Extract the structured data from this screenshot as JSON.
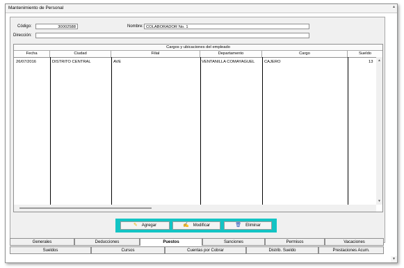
{
  "window": {
    "title": "Mantenimiento de Personal"
  },
  "form": {
    "codigo_label": "Código:",
    "codigo_value": "30002588",
    "nombre_label": "Nombre:",
    "nombre_value": "COLABORADOR No. 1",
    "direccion_label": "Dirección:",
    "direccion_value": ""
  },
  "grid": {
    "title": "Cargos y ubicaciones del empleado",
    "columns": [
      "Fecha",
      "Ciudad",
      "Filial",
      "Departamento",
      "Cargo",
      "Sueldo"
    ],
    "rows": [
      {
        "fecha": "26/07/2016",
        "ciudad": "DISTRITO CENTRAL",
        "filial": "AVE",
        "departamento": "VENTANILLA COMAYAGUEL",
        "cargo": "CAJERO",
        "sueldo": "13"
      }
    ]
  },
  "actions": {
    "add": "Agregar",
    "modify": "Modificar",
    "delete": "Eliminar"
  },
  "tabs_row1": [
    "Generales",
    "Deducciones",
    "Puestos",
    "Sanciones",
    "Permisos",
    "Vacaciones"
  ],
  "tabs_row2": [
    "Sueldos",
    "Cursos",
    "Cuentas por Cobrar",
    "Distrib. Sueldo",
    "Prestaciones Acum."
  ],
  "active_tab": "Puestos",
  "colors": {
    "accent_bar": "#13c4c4",
    "pencil": "#e8b400",
    "trash": "#1f4fb5"
  }
}
